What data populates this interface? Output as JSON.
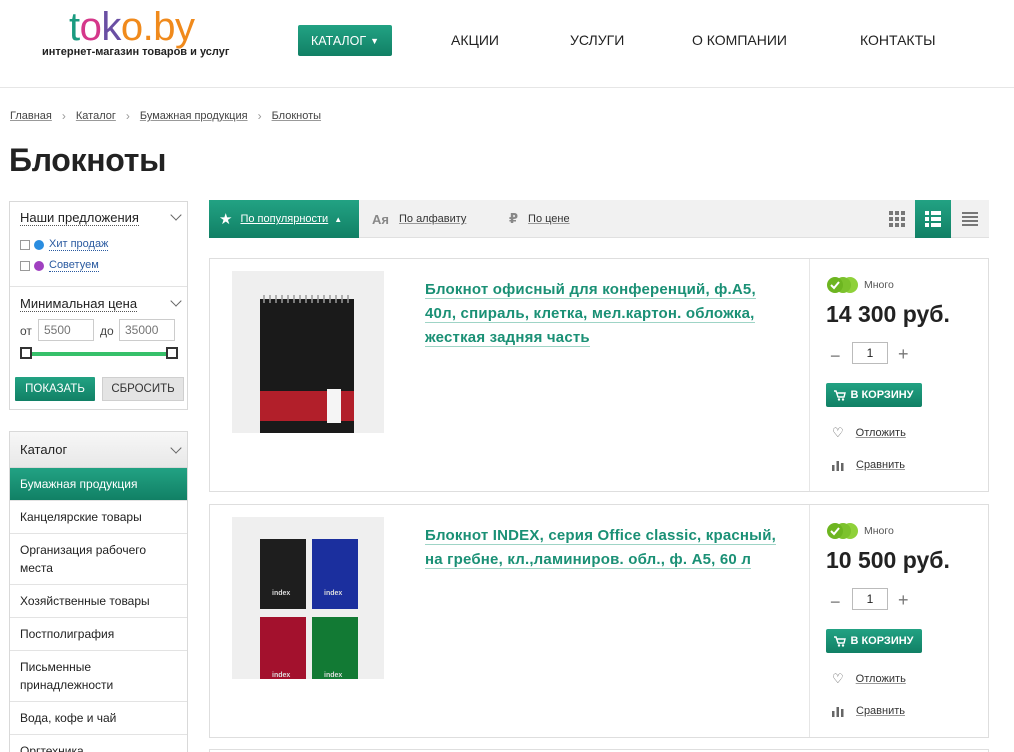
{
  "header": {
    "logo": {
      "part1": "t",
      "part2": "o",
      "part3": "k",
      "part4": "o.by"
    },
    "tagline": "интернет-магазин товаров и услуг",
    "nav": {
      "catalog": "КАТАЛОГ",
      "promo": "АКЦИИ",
      "services": "УСЛУГИ",
      "about": "О КОМПАНИИ",
      "contacts": "КОНТАКТЫ"
    }
  },
  "breadcrumb": [
    "Главная",
    "Каталог",
    "Бумажная продукция",
    "Блокноты"
  ],
  "page_title": "Блокноты",
  "filters": {
    "offers_title": "Наши предложения",
    "offers": [
      {
        "label": "Хит продаж",
        "color": "#2a8de0"
      },
      {
        "label": "Советуем",
        "color": "#a040c0"
      }
    ],
    "price_title": "Минимальная цена",
    "price_from_label": "от",
    "price_to_label": "до",
    "price_from_placeholder": "5500",
    "price_to_placeholder": "35000",
    "show_button": "ПОКАЗАТЬ",
    "reset_button": "СБРОСИТЬ"
  },
  "catalog": {
    "title": "Каталог",
    "items": [
      "Бумажная продукция",
      "Канцелярские товары",
      "Организация рабочего места",
      "Хозяйственные товары",
      "Постполиграфия",
      "Письменные принадлежности",
      "Вода, кофе и чай",
      "Оргтехника"
    ],
    "active_index": 0
  },
  "sort": {
    "popularity": "По популярности",
    "alphabet_icon": "Ая",
    "alphabet": "По алфавиту",
    "price_icon": "₽",
    "price": "По цене"
  },
  "products": [
    {
      "title": "Блокнот офисный для конференций, ф.А5, 40л, спираль, клетка, мел.картон. обложка, жесткая задняя часть",
      "stock": "Много",
      "price": "14 300 руб.",
      "qty": "1",
      "cart": "В КОРЗИНУ",
      "defer": "Отложить",
      "compare": "Сравнить"
    },
    {
      "title": "Блокнот INDEX, серия Office classic, красный, на гребне, кл.,ламиниров. обл., ф. А5, 60 л",
      "stock": "Много",
      "price": "10 500 руб.",
      "qty": "1",
      "cart": "В КОРЗИНУ",
      "defer": "Отложить",
      "compare": "Сравнить"
    }
  ],
  "colors": {
    "accent": "#1a9075",
    "slider": "#36c06a"
  },
  "icons": [
    "star-icon",
    "chevron-down-icon",
    "heart-icon",
    "compare-bars-icon",
    "grid-view-icon",
    "list-view-icon",
    "table-view-icon",
    "stock-check-icon",
    "cart-icon"
  ]
}
